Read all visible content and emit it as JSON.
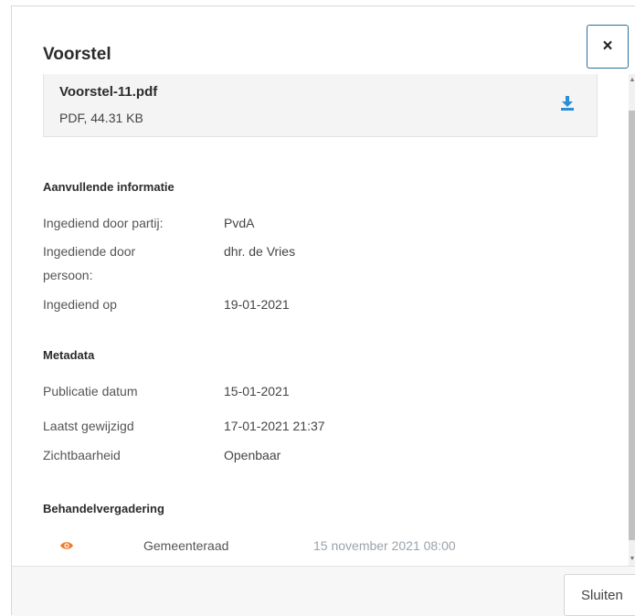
{
  "modal": {
    "title": "Voorstel",
    "close_label": "×"
  },
  "file": {
    "name": "Voorstel-11.pdf",
    "meta": "PDF, 44.31 KB",
    "download_icon": "download-icon"
  },
  "extra_info": {
    "title": "Aanvullende informatie",
    "rows": [
      {
        "label": "Ingediend door partij:",
        "value": "PvdA"
      },
      {
        "label": "Ingediende door persoon:",
        "value": "dhr. de Vries"
      },
      {
        "label": "Ingediend op",
        "value": "19-01-2021"
      }
    ]
  },
  "metadata": {
    "title": "Metadata",
    "rows": [
      {
        "label": "Publicatie datum",
        "value": "15-01-2021"
      },
      {
        "label": "Laatst gewijzigd",
        "value": "17-01-2021 21:37"
      },
      {
        "label": "Zichtbaarheid",
        "value": "Openbaar"
      }
    ]
  },
  "meetings": {
    "title": "Behandelvergadering",
    "items": [
      {
        "icon": "eye-icon",
        "name": "Gemeenteraad",
        "date": "15 november 2021 08:00"
      }
    ]
  },
  "footer": {
    "close_button": "Sluiten"
  },
  "colors": {
    "accent": "#2a8fd6",
    "eye": "#f07a2a",
    "muted_date": "#9aa3ab"
  }
}
